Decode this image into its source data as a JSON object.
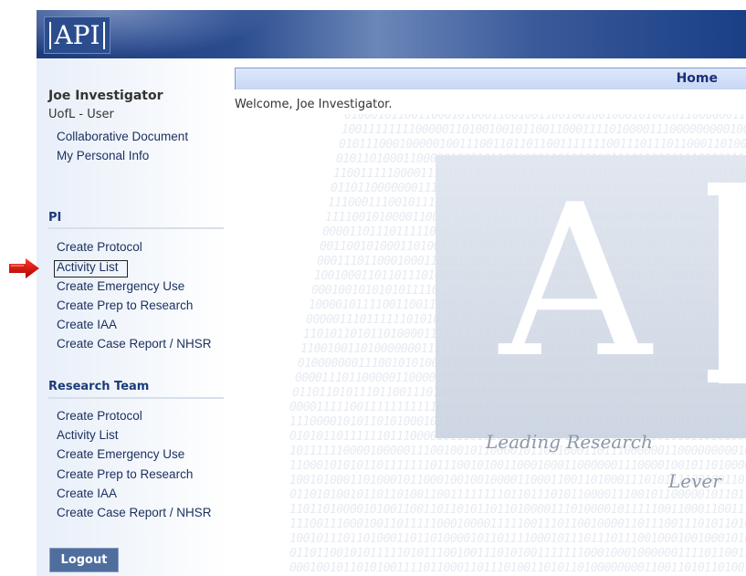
{
  "header": {
    "logo_text": "API"
  },
  "sidebar": {
    "user_name": "Joe Investigator",
    "user_role": "UofL - User",
    "user_links": [
      "Collaborative Document",
      "My Personal Info"
    ],
    "sections": [
      {
        "title": "PI",
        "items": [
          "Create Protocol",
          "Activity List",
          "Create Emergency Use",
          "Create Prep to Research",
          "Create IAA",
          "Create Case Report / NHSR"
        ]
      },
      {
        "title": "Research Team",
        "items": [
          "Create Protocol",
          "Activity List",
          "Create Emergency Use",
          "Create Prep to Research",
          "Create IAA",
          "Create Case Report / NHSR"
        ]
      }
    ],
    "logout_label": "Logout"
  },
  "main": {
    "title": "Home",
    "welcome": "Welcome, Joe Investigator.",
    "background_tagline_1": "Leading Research",
    "background_tagline_2": "Lever"
  },
  "colors": {
    "header_blue": "#1c3a7a",
    "accent_red": "#d40000",
    "section_title": "#1b3b7a"
  }
}
